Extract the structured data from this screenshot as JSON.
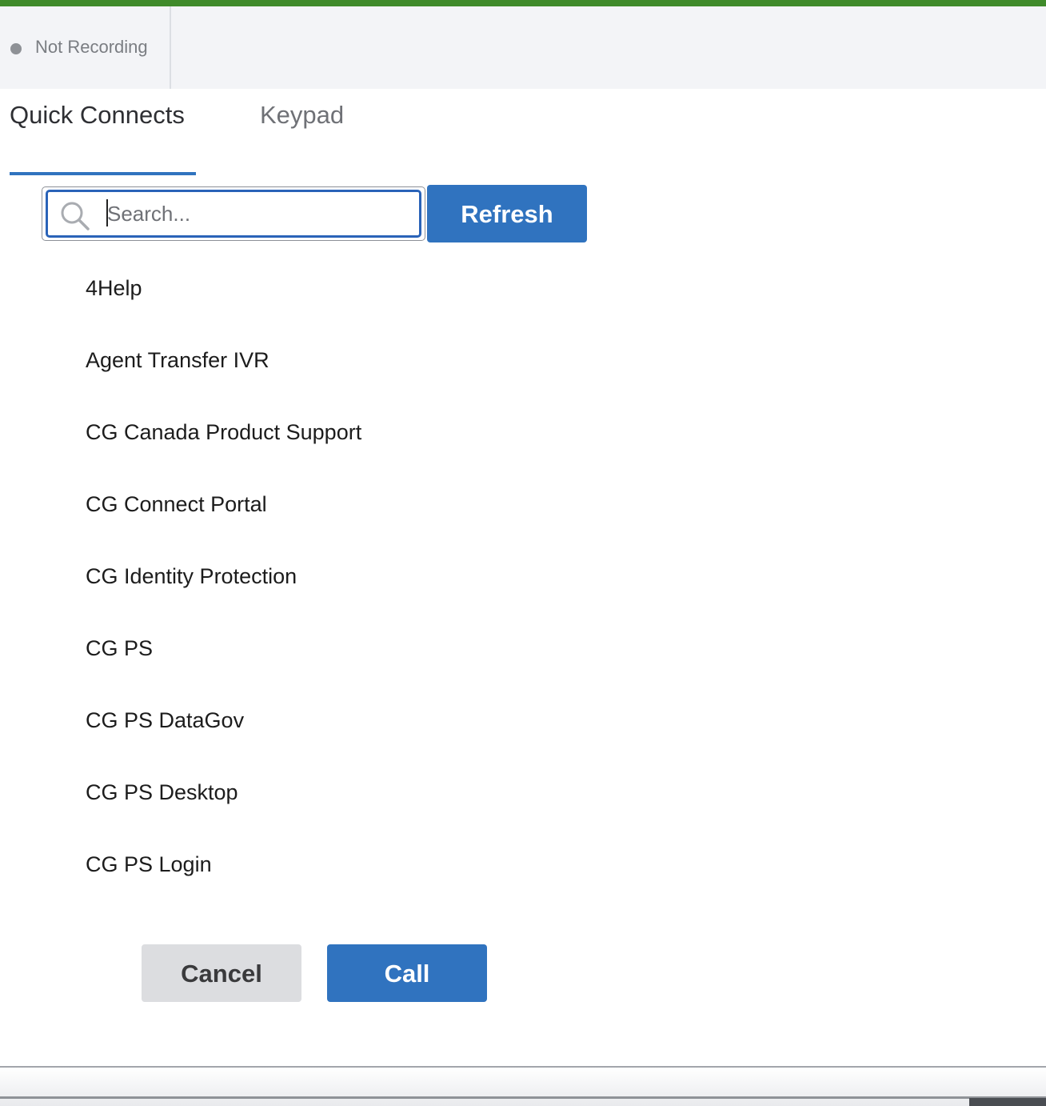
{
  "header": {
    "recording_status": "Not Recording"
  },
  "tabs": [
    {
      "label": "Quick Connects",
      "active": true
    },
    {
      "label": "Keypad",
      "active": false
    }
  ],
  "search": {
    "placeholder": "Search...",
    "value": "",
    "icon": "search-icon"
  },
  "toolbar": {
    "refresh_label": "Refresh"
  },
  "quick_connects": [
    {
      "label": "4Help"
    },
    {
      "label": "Agent Transfer IVR"
    },
    {
      "label": "CG Canada Product Support"
    },
    {
      "label": "CG Connect Portal"
    },
    {
      "label": "CG Identity Protection"
    },
    {
      "label": "CG PS"
    },
    {
      "label": "CG PS DataGov"
    },
    {
      "label": "CG PS Desktop"
    },
    {
      "label": "CG PS Login"
    }
  ],
  "actions": {
    "cancel_label": "Cancel",
    "call_label": "Call"
  },
  "colors": {
    "accent_green": "#3f8a2a",
    "primary_blue": "#3073bf",
    "focus_blue": "#2a63b8",
    "neutral_button": "#dcdde0"
  }
}
